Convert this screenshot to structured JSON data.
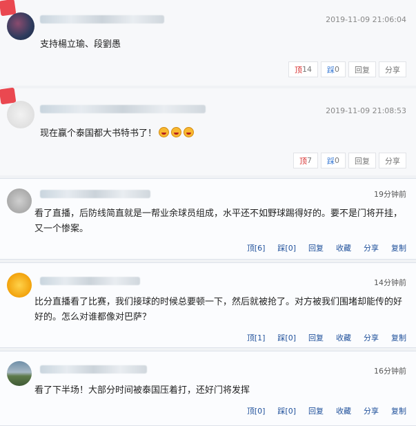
{
  "comments": [
    {
      "time": "2019-11-09 21:06:04",
      "text": "支持楊立瑜、段劉愚",
      "actions": {
        "up": "顶",
        "up_count": "14",
        "down": "踩",
        "down_count": "0",
        "reply": "回复",
        "share": "分享"
      }
    },
    {
      "time": "2019-11-09 21:08:53",
      "text": "现在赢个泰国都大书特书了！",
      "actions": {
        "up": "顶",
        "up_count": "7",
        "down": "踩",
        "down_count": "0",
        "reply": "回复",
        "share": "分享"
      }
    },
    {
      "time": "19分钟前",
      "text": "看了直播，后防线简直就是一帮业余球员组成，水平还不如野球踢得好的。要不是门将开挂，又一个惨案。",
      "actions": {
        "up": "顶[6]",
        "down": "踩[0]",
        "reply": "回复",
        "collect": "收藏",
        "share": "分享",
        "copy": "复制"
      }
    },
    {
      "time": "14分钟前",
      "text": "比分直播看了比赛，我们接球的时候总要顿一下，然后就被抢了。对方被我们围堵却能传的好好的。怎么对谁都像对巴萨？",
      "actions": {
        "up": "顶[1]",
        "down": "踩[0]",
        "reply": "回复",
        "collect": "收藏",
        "share": "分享",
        "copy": "复制"
      }
    },
    {
      "time": "16分钟前",
      "text": "看了下半场！大部分时间被泰国压着打，还好门将发挥",
      "actions": {
        "up": "顶[0]",
        "down": "踩[0]",
        "reply": "回复",
        "collect": "收藏",
        "share": "分享",
        "copy": "复制"
      }
    }
  ],
  "colors": {
    "accent_red": "#d62c2c",
    "link_blue": "#1e4f9a"
  }
}
